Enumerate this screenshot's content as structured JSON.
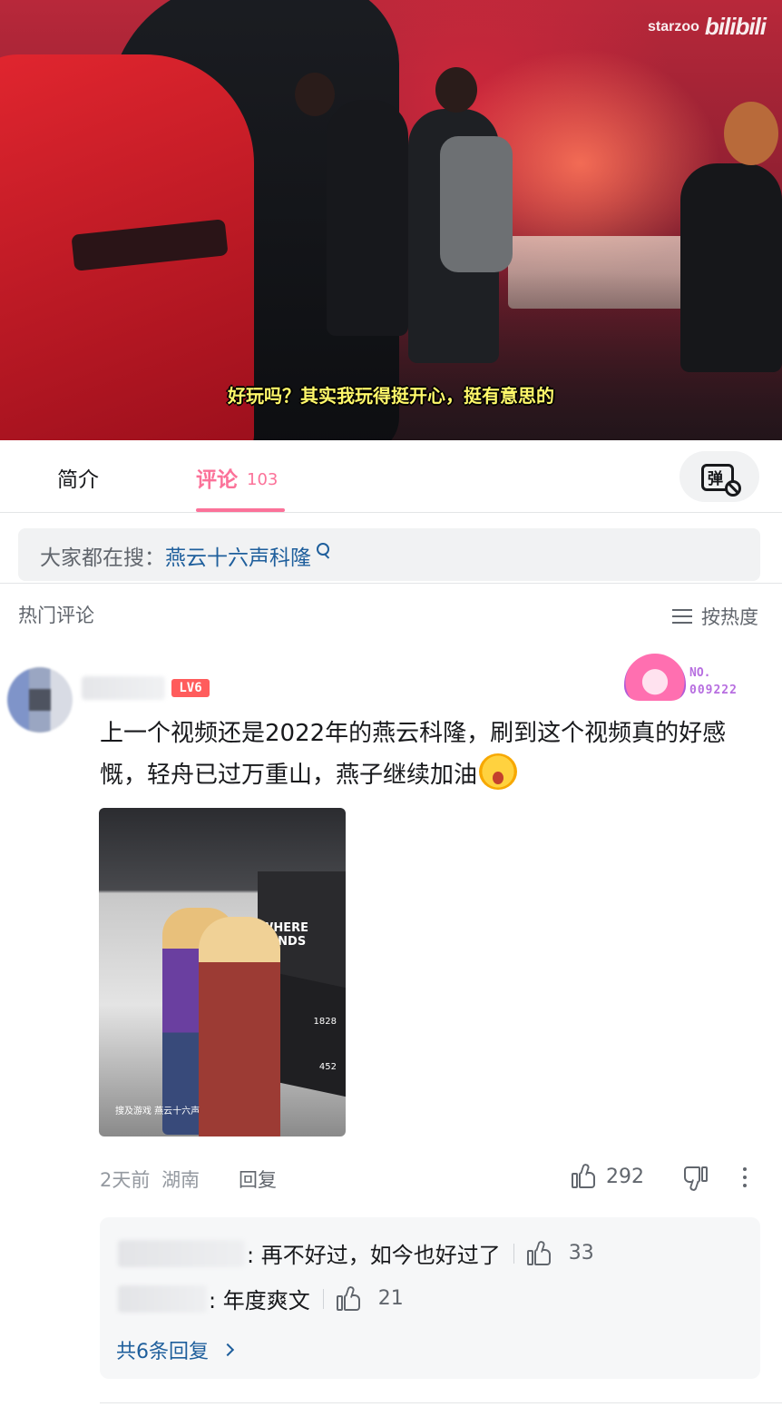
{
  "video": {
    "watermark_brand": "starzoo",
    "watermark_site": "bilibili",
    "subtitle": "好玩吗？其实我玩得挺开心，挺有意思的"
  },
  "tabs": {
    "intro_label": "简介",
    "comments_label": "评论",
    "comments_count": "103",
    "active_color": "#fb7299"
  },
  "search_suggest": {
    "prefix": "大家都在搜：",
    "keyword": "燕云十六声科隆"
  },
  "comments_header": {
    "title": "热门评论",
    "sort_label": "按热度"
  },
  "comment": {
    "level_badge": "LV6",
    "fan_badge": {
      "label": "NO.",
      "number": "009222"
    },
    "text": "上一个视频还是2022年的燕云科隆，刷到这个视频真的好感慨，轻舟已过万重山，燕子继续加油",
    "emoji": "surprised-face-emoji",
    "image": {
      "wall_text": "WHERE WINDS",
      "caption": "搜及游戏  燕云十六声",
      "side_numbers": [
        "1828",
        "452"
      ]
    },
    "time": "2天前",
    "location": "湖南",
    "reply_label": "回复",
    "likes": "292"
  },
  "replies": {
    "items": [
      {
        "text": ": 再不好过，如今也好过了",
        "likes": "33"
      },
      {
        "text": ": 年度爽文",
        "likes": "21"
      }
    ],
    "view_all": "共6条回复"
  }
}
